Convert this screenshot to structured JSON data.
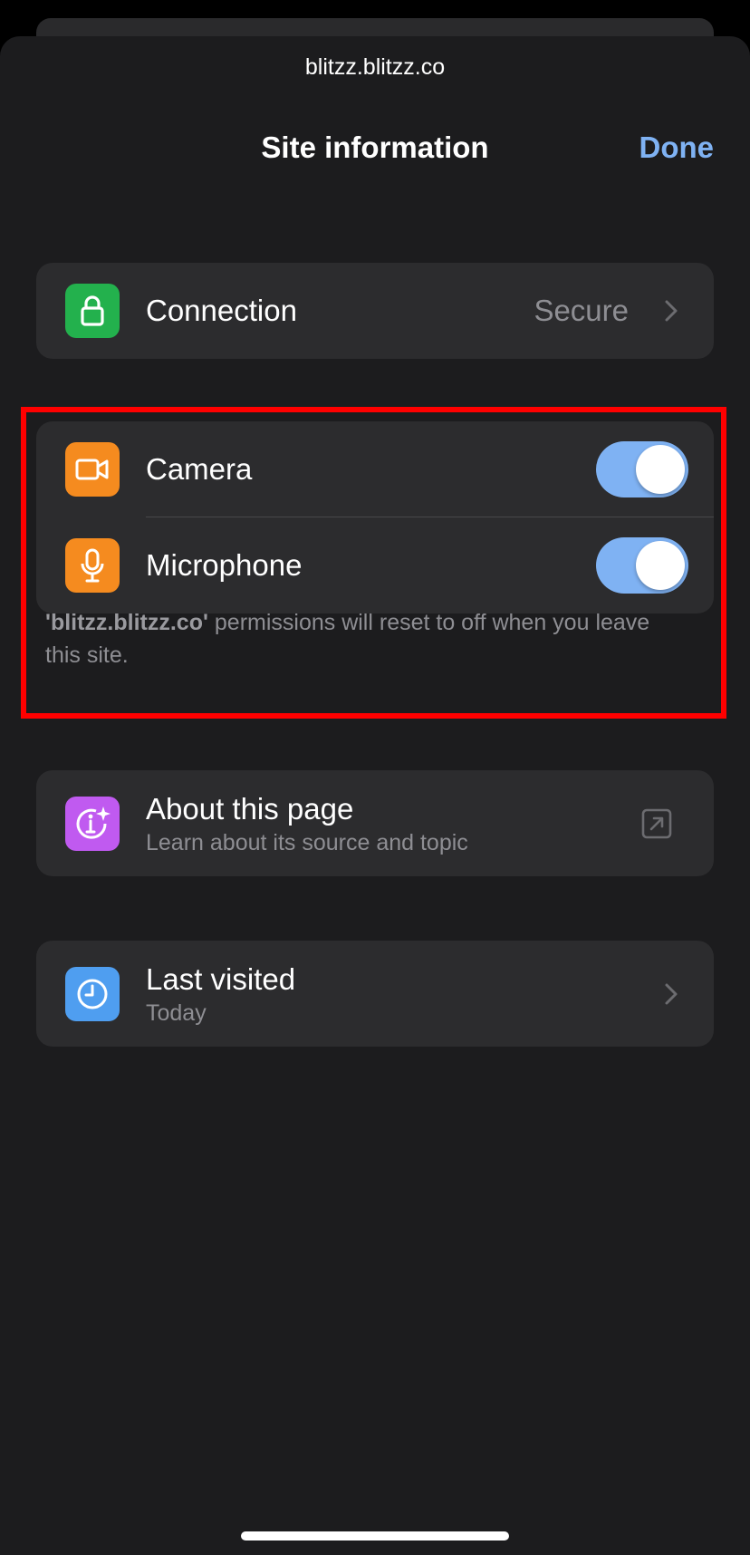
{
  "header": {
    "url": "blitzz.blitzz.co",
    "title": "Site information",
    "done_label": "Done"
  },
  "connection": {
    "label": "Connection",
    "value": "Secure",
    "icon": "lock-icon"
  },
  "permissions": {
    "items": [
      {
        "label": "Camera",
        "icon": "camera-icon",
        "enabled": true
      },
      {
        "label": "Microphone",
        "icon": "microphone-icon",
        "enabled": true
      }
    ],
    "footnote_site": "'blitzz.blitzz.co'",
    "footnote_text": " permissions will reset to off when you leave this site."
  },
  "about": {
    "label": "About this page",
    "sublabel": "Learn about its source and topic",
    "icon": "info-sparkle-icon"
  },
  "last_visited": {
    "label": "Last visited",
    "sublabel": "Today",
    "icon": "clock-icon"
  },
  "colors": {
    "accent": "#7fb2f3",
    "background": "#1c1c1e",
    "card": "#2c2c2e",
    "highlight": "#ff0000"
  }
}
